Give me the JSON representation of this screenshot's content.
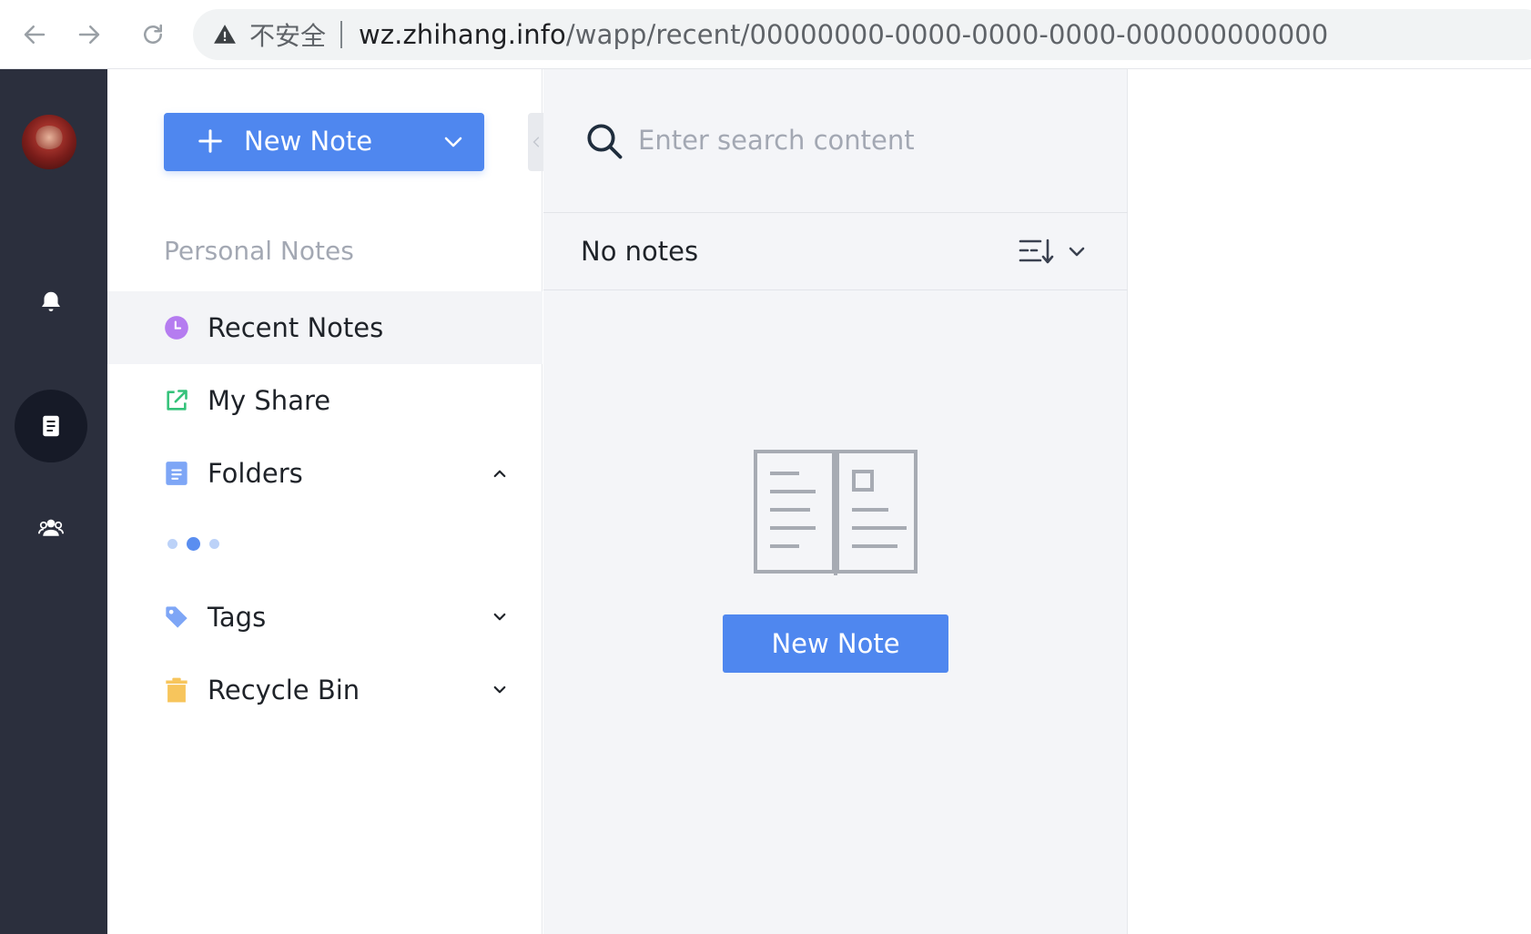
{
  "browser": {
    "insecure_label": "不安全",
    "url_host": "wz.zhihang.info",
    "url_path": "/wapp/recent/00000000-0000-0000-0000-000000000000"
  },
  "rail": {
    "items": [
      {
        "icon": "bell-icon"
      },
      {
        "icon": "note-icon",
        "active": true
      },
      {
        "icon": "users-icon"
      }
    ]
  },
  "sidebar": {
    "new_note_label": "New Note",
    "section_title": "Personal Notes",
    "items": [
      {
        "label": "Recent Notes",
        "icon": "clock-icon",
        "color": "#b57cf0",
        "active": true
      },
      {
        "label": "My Share",
        "icon": "share-icon",
        "color": "#34c27a"
      },
      {
        "label": "Folders",
        "icon": "folder-doc-icon",
        "color": "#7ea6f6",
        "expanded": true
      },
      {
        "label": "Tags",
        "icon": "tag-icon",
        "color": "#7ea6f6",
        "expanded": false
      },
      {
        "label": "Recycle Bin",
        "icon": "trash-icon",
        "color": "#f7c55c",
        "expanded": false
      }
    ]
  },
  "list": {
    "search_placeholder": "Enter search content",
    "empty_label": "No notes",
    "empty_button_label": "New Note"
  },
  "colors": {
    "accent": "#4f87ef",
    "rail_bg": "#2b2f3d",
    "list_bg": "#f4f5f8"
  }
}
